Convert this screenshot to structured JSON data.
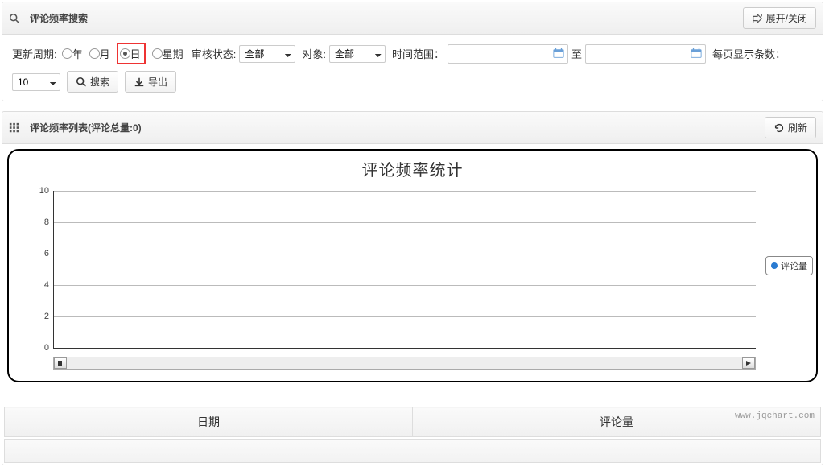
{
  "search_panel": {
    "title": "评论频率搜索",
    "toggle_btn": "展开/关闭",
    "update_cycle_label": "更新周期:",
    "radio_year": "年",
    "radio_month": "月",
    "radio_day": "日",
    "radio_week": "星期",
    "audit_status_label": "审核状态:",
    "audit_status_value": "全部",
    "target_label": "对象:",
    "target_value": "全部",
    "time_range_label": "时间范围：",
    "to_label": "至",
    "per_page_label": "每页显示条数：",
    "per_page_value": "10",
    "search_btn": "搜索",
    "export_btn": "导出"
  },
  "list_panel": {
    "title": "评论频率列表(评论总量:0)",
    "refresh_btn": "刷新"
  },
  "chart_data": {
    "type": "line",
    "title": "评论频率统计",
    "categories": [],
    "series": [
      {
        "name": "评论量",
        "values": []
      }
    ],
    "ylabel": "",
    "xlabel": "",
    "ylim": [
      0,
      10
    ],
    "yticks": [
      0,
      2,
      4,
      6,
      8,
      10
    ],
    "legend_position": "right",
    "grid": true,
    "watermark": "www.jqchart.com"
  },
  "table": {
    "col_date": "日期",
    "col_count": "评论量"
  }
}
